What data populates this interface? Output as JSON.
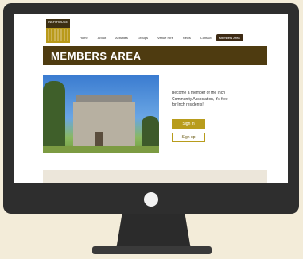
{
  "site": {
    "logo_text": "INCH HOUSE"
  },
  "nav": {
    "items": [
      "Home",
      "About",
      "Activities",
      "Groups",
      "Venue Hire",
      "News",
      "Contact",
      "Members Area"
    ]
  },
  "banner": {
    "title": "MEMBERS AREA"
  },
  "promo": {
    "text": "Become a member of the Inch Community Association, it's free for Inch residents!",
    "signin_label": "Sign in",
    "signup_label": "Sign up"
  },
  "colors": {
    "background": "#f3ecd9",
    "monitor": "#2e2e2e",
    "banner": "#4e3b10",
    "accent": "#b89c1c",
    "nav_active": "#3d2a14"
  }
}
